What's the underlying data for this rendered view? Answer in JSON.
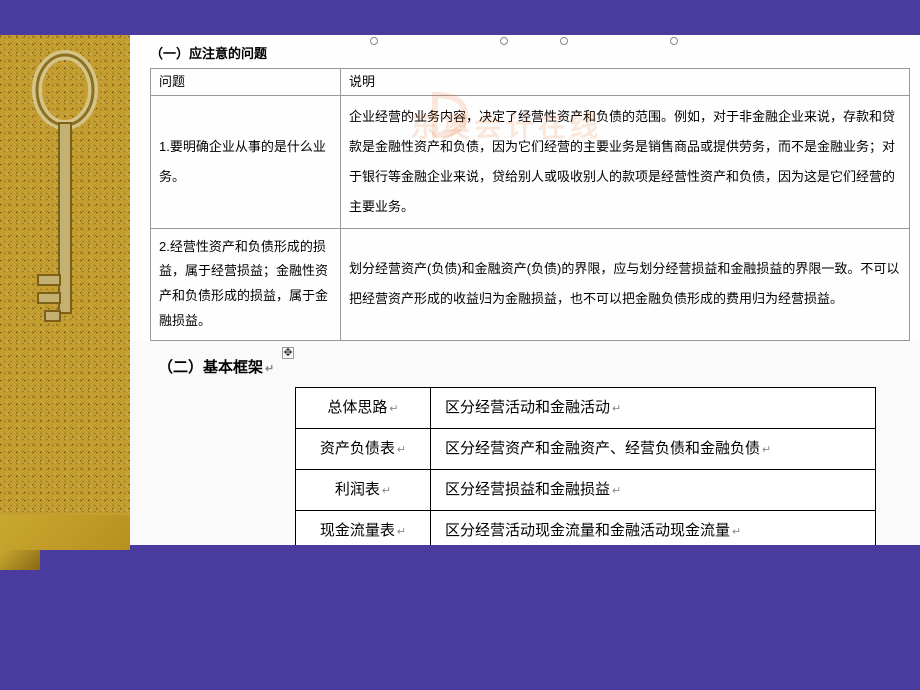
{
  "section1": {
    "title": "（一）应注意的问题",
    "headers": {
      "col1": "问题",
      "col2": "说明"
    },
    "rows": [
      {
        "problem": "1.要明确企业从事的是什么业务。",
        "explanation": "企业经营的业务内容，决定了经营性资产和负债的范围。例如，对于非金融企业来说，存款和贷款是金融性资产和负债，因为它们经营的主要业务是销售商品或提供劳务，而不是金融业务；对于银行等金融企业来说，贷给别人或吸收别人的款项是经营性资产和负债，因为这是它们经营的主要业务。"
      },
      {
        "problem": "2.经营性资产和负债形成的损益，属于经营损益；金融性资产和负债形成的损益，属于金融损益。",
        "explanation": "划分经营资产(负债)和金融资产(负债)的界限，应与划分经营损益和金融损益的界限一致。不可以把经营资产形成的收益归为金融损益，也不可以把金融负债形成的费用归为经营损益。"
      }
    ]
  },
  "section2": {
    "title": "（二）基本框架",
    "rows": [
      {
        "label": "总体思路",
        "value": "区分经营活动和金融活动"
      },
      {
        "label": "资产负债表",
        "value": "区分经营资产和金融资产、经营负债和金融负债"
      },
      {
        "label": "利润表",
        "value": "区分经营损益和金融损益"
      },
      {
        "label": "现金流量表",
        "value": "区分经营活动现金流量和金融活动现金流量"
      }
    ]
  },
  "watermark": "东奥会计在线",
  "ret": "↵"
}
